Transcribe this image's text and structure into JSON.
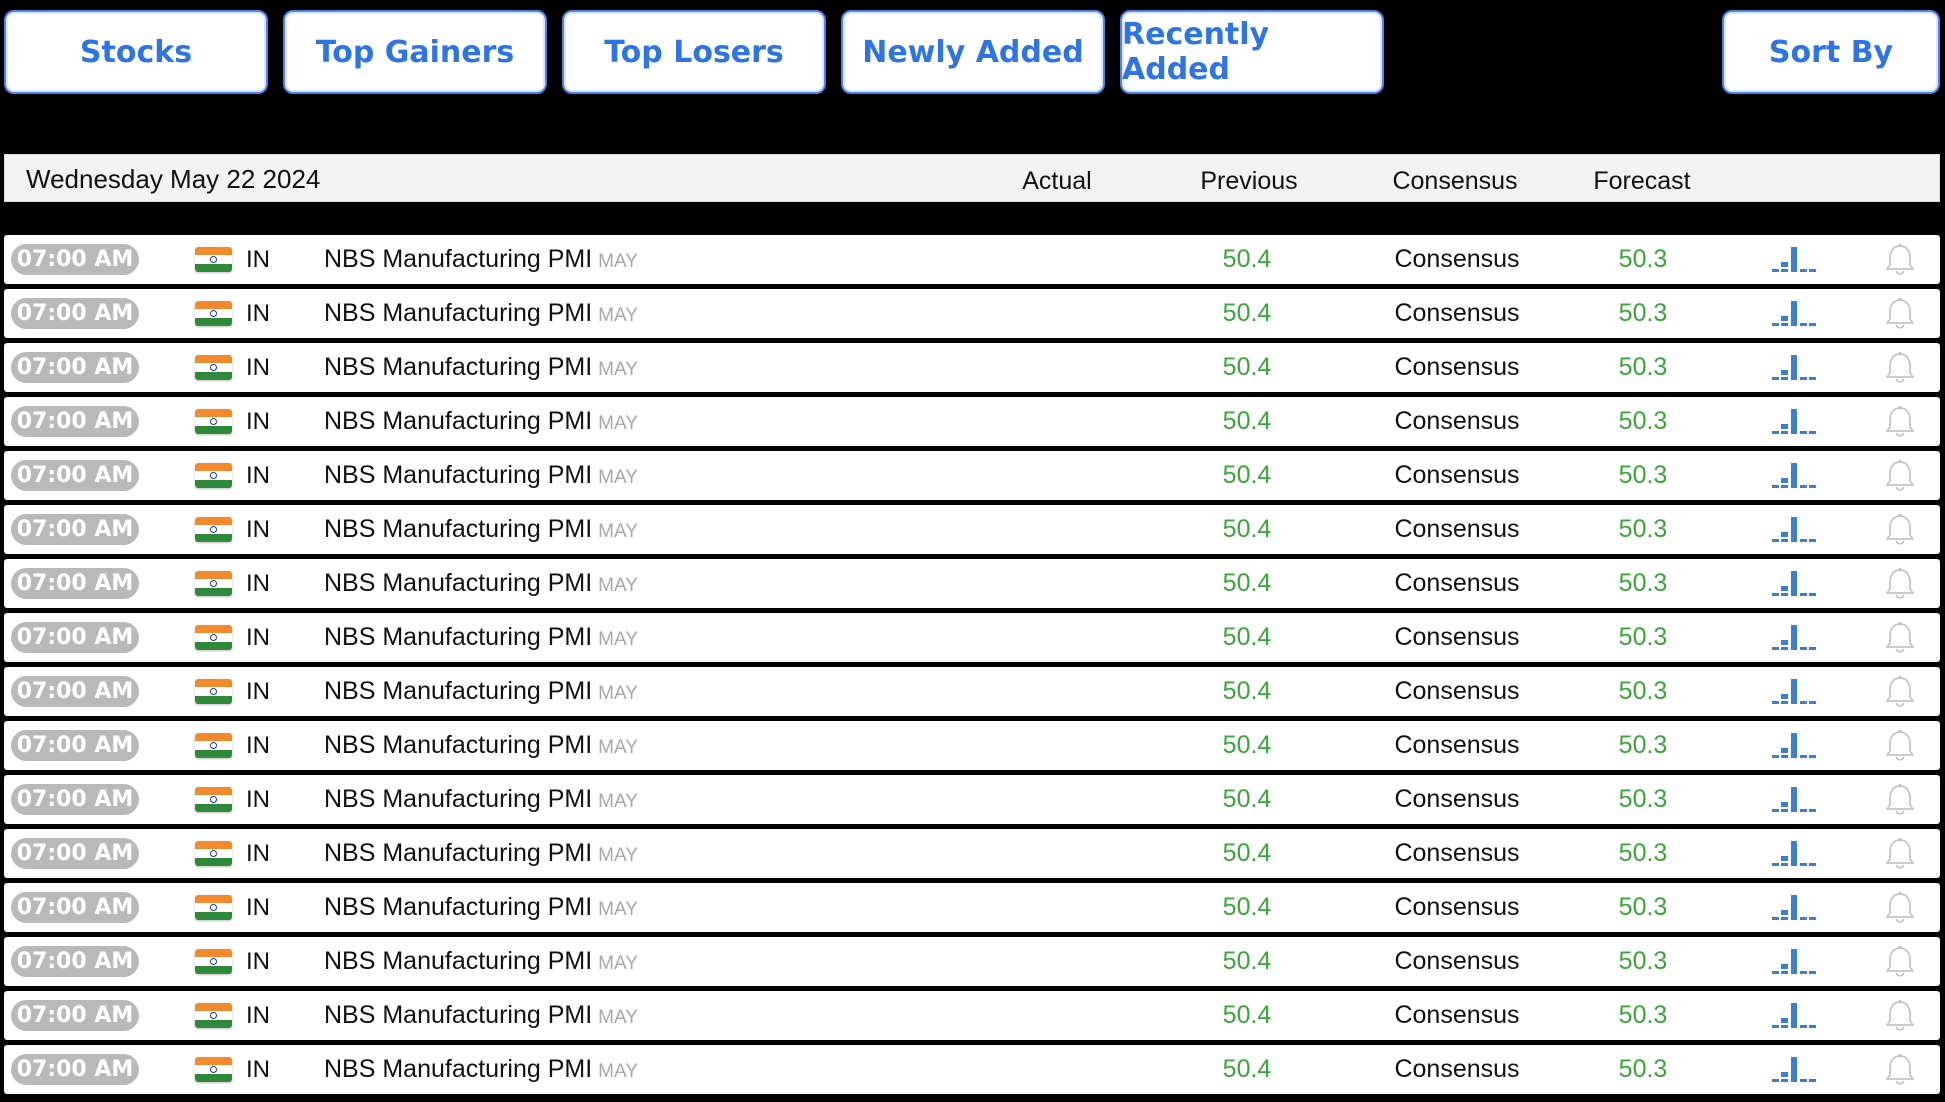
{
  "nav": {
    "tabs": [
      {
        "label": "Stocks"
      },
      {
        "label": "Top Gainers"
      },
      {
        "label": "Top Losers"
      },
      {
        "label": "Newly Added"
      },
      {
        "label": "Recently Added"
      }
    ],
    "sort_label": "Sort By"
  },
  "header": {
    "date": "Wednesday May 22 2024",
    "columns": {
      "actual": "Actual",
      "previous": "Previous",
      "consensus": "Consensus",
      "forecast": "Forecast"
    }
  },
  "icons": {
    "chart": "bar-chart-icon",
    "bell": "bell-icon",
    "flag": "india-flag-icon"
  },
  "colors": {
    "accent": "#2f74e3",
    "positive": "#3aa53a",
    "time_pill": "#b9b9b9",
    "chart": "#3b7fd4"
  },
  "rows": [
    {
      "time": "07:00 AM",
      "country": "IN",
      "event": "NBS Manufacturing PMI",
      "period": "MAY",
      "actual": "",
      "previous": "50.4",
      "consensus": "Consensus",
      "forecast": "50.3"
    },
    {
      "time": "07:00 AM",
      "country": "IN",
      "event": "NBS Manufacturing PMI",
      "period": "MAY",
      "actual": "",
      "previous": "50.4",
      "consensus": "Consensus",
      "forecast": "50.3"
    },
    {
      "time": "07:00 AM",
      "country": "IN",
      "event": "NBS Manufacturing PMI",
      "period": "MAY",
      "actual": "",
      "previous": "50.4",
      "consensus": "Consensus",
      "forecast": "50.3"
    },
    {
      "time": "07:00 AM",
      "country": "IN",
      "event": "NBS Manufacturing PMI",
      "period": "MAY",
      "actual": "",
      "previous": "50.4",
      "consensus": "Consensus",
      "forecast": "50.3"
    },
    {
      "time": "07:00 AM",
      "country": "IN",
      "event": "NBS Manufacturing PMI",
      "period": "MAY",
      "actual": "",
      "previous": "50.4",
      "consensus": "Consensus",
      "forecast": "50.3"
    },
    {
      "time": "07:00 AM",
      "country": "IN",
      "event": "NBS Manufacturing PMI",
      "period": "MAY",
      "actual": "",
      "previous": "50.4",
      "consensus": "Consensus",
      "forecast": "50.3"
    },
    {
      "time": "07:00 AM",
      "country": "IN",
      "event": "NBS Manufacturing PMI",
      "period": "MAY",
      "actual": "",
      "previous": "50.4",
      "consensus": "Consensus",
      "forecast": "50.3"
    },
    {
      "time": "07:00 AM",
      "country": "IN",
      "event": "NBS Manufacturing PMI",
      "period": "MAY",
      "actual": "",
      "previous": "50.4",
      "consensus": "Consensus",
      "forecast": "50.3"
    },
    {
      "time": "07:00 AM",
      "country": "IN",
      "event": "NBS Manufacturing PMI",
      "period": "MAY",
      "actual": "",
      "previous": "50.4",
      "consensus": "Consensus",
      "forecast": "50.3"
    },
    {
      "time": "07:00 AM",
      "country": "IN",
      "event": "NBS Manufacturing PMI",
      "period": "MAY",
      "actual": "",
      "previous": "50.4",
      "consensus": "Consensus",
      "forecast": "50.3"
    },
    {
      "time": "07:00 AM",
      "country": "IN",
      "event": "NBS Manufacturing PMI",
      "period": "MAY",
      "actual": "",
      "previous": "50.4",
      "consensus": "Consensus",
      "forecast": "50.3"
    },
    {
      "time": "07:00 AM",
      "country": "IN",
      "event": "NBS Manufacturing PMI",
      "period": "MAY",
      "actual": "",
      "previous": "50.4",
      "consensus": "Consensus",
      "forecast": "50.3"
    },
    {
      "time": "07:00 AM",
      "country": "IN",
      "event": "NBS Manufacturing PMI",
      "period": "MAY",
      "actual": "",
      "previous": "50.4",
      "consensus": "Consensus",
      "forecast": "50.3"
    },
    {
      "time": "07:00 AM",
      "country": "IN",
      "event": "NBS Manufacturing PMI",
      "period": "MAY",
      "actual": "",
      "previous": "50.4",
      "consensus": "Consensus",
      "forecast": "50.3"
    },
    {
      "time": "07:00 AM",
      "country": "IN",
      "event": "NBS Manufacturing PMI",
      "period": "MAY",
      "actual": "",
      "previous": "50.4",
      "consensus": "Consensus",
      "forecast": "50.3"
    },
    {
      "time": "07:00 AM",
      "country": "IN",
      "event": "NBS Manufacturing PMI",
      "period": "MAY",
      "actual": "",
      "previous": "50.4",
      "consensus": "Consensus",
      "forecast": "50.3"
    }
  ]
}
